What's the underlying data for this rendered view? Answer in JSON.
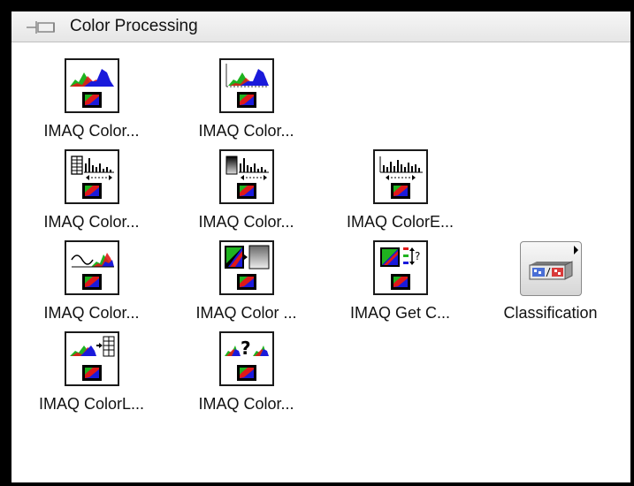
{
  "palette": {
    "title": "Color Processing",
    "items": [
      {
        "label": "IMAQ Color...",
        "icon": "color-histogram-icon"
      },
      {
        "label": "IMAQ Color...",
        "icon": "color-histogram-graph-icon"
      },
      {
        "label": "IMAQ Color...",
        "icon": "color-lookup-histogram-icon"
      },
      {
        "label": "IMAQ Color...",
        "icon": "color-equalize-gradient-icon"
      },
      {
        "label": "IMAQ ColorE...",
        "icon": "color-equalize-icon"
      },
      {
        "label": "IMAQ Color...",
        "icon": "color-threshold-icon"
      },
      {
        "label": "IMAQ Color ...",
        "icon": "color-replace-icon"
      },
      {
        "label": "IMAQ Get C...",
        "icon": "get-color-pixel-icon"
      },
      {
        "label": "Classification",
        "icon": "classification-subpalette-icon"
      },
      {
        "label": "IMAQ ColorL...",
        "icon": "color-learn-icon"
      },
      {
        "label": "IMAQ Color...",
        "icon": "color-match-icon"
      }
    ]
  }
}
